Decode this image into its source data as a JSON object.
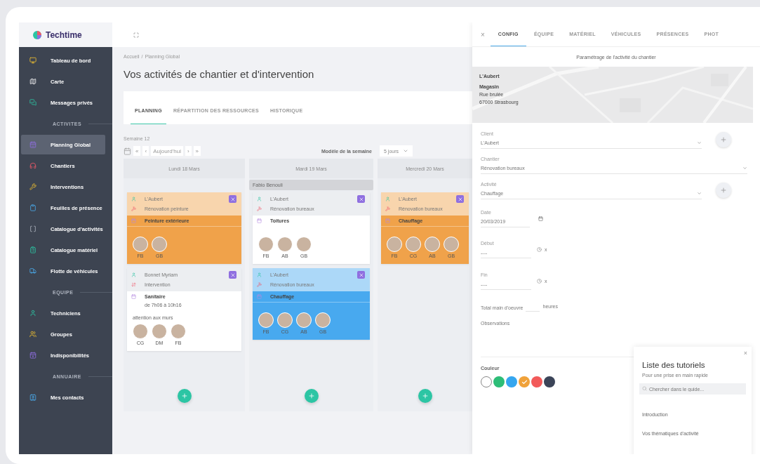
{
  "brand": "Techtime",
  "sidebar": {
    "items": [
      {
        "kind": "item",
        "label": "Tableau de bord",
        "selected": false
      },
      {
        "kind": "item",
        "label": "Carte",
        "selected": false
      },
      {
        "kind": "item",
        "label": "Messages privés",
        "selected": false
      },
      {
        "kind": "section",
        "label": "ACTIVITES"
      },
      {
        "kind": "item",
        "label": "Planning Global",
        "selected": true
      },
      {
        "kind": "item",
        "label": "Chantiers",
        "selected": false
      },
      {
        "kind": "item",
        "label": "Interventions",
        "selected": false
      },
      {
        "kind": "item",
        "label": "Feuilles de présence",
        "selected": false
      },
      {
        "kind": "item",
        "label": "Catalogue d'activités",
        "selected": false
      },
      {
        "kind": "item",
        "label": "Catalogue matériel",
        "selected": false
      },
      {
        "kind": "item",
        "label": "Flotte de véhicules",
        "selected": false
      },
      {
        "kind": "section",
        "label": "EQUIPE"
      },
      {
        "kind": "item",
        "label": "Techniciens",
        "selected": false
      },
      {
        "kind": "item",
        "label": "Groupes",
        "selected": false
      },
      {
        "kind": "item",
        "label": "Indisponibilités",
        "selected": false
      },
      {
        "kind": "section",
        "label": "ANNUAIRE"
      },
      {
        "kind": "item",
        "label": "Mes contacts",
        "selected": false
      }
    ]
  },
  "breadcrumb": [
    "Accueil",
    "/",
    "Planning Global"
  ],
  "title": "Vos activités de chantier et d'intervention",
  "tabs": [
    {
      "label": "PLANNING",
      "selected": true
    },
    {
      "label": "RÉPARTITION DES RESSOURCES",
      "selected": false
    },
    {
      "label": "HISTORIQUE",
      "selected": false
    }
  ],
  "week": "Semaine 12",
  "toolbar": {
    "first": "«",
    "prev": "‹",
    "today": "Aujourd'hui",
    "next": "›",
    "last": "»",
    "model_label": "Modèle de la semaine",
    "model_value": "5 jours"
  },
  "columns": [
    {
      "day": "Lundi 18 Mars",
      "cards": [
        {
          "color": "#f0a24a",
          "client": "L'Aubert",
          "site": "Rénovation peinture",
          "kind": "worksite",
          "activity": "Peinture extérieure",
          "team": [
            "FB",
            "GB"
          ]
        },
        {
          "color": "#ffffff",
          "client": "Bonnet Myriam",
          "site": "Intervention",
          "kind": "service",
          "activity": "Sanitaire",
          "time": "de 7h06 à 10h16",
          "note": "attention aux murs",
          "team": [
            "CG",
            "DM",
            "FB"
          ]
        }
      ]
    },
    {
      "day": "Mardi 19 Mars",
      "absence": "Fabio Benouli",
      "cards": [
        {
          "color": "#ffffff",
          "client": "L'Aubert",
          "site": "Rénovation bureaux",
          "kind": "worksite",
          "activity": "Toitures",
          "team": [
            "FB",
            "AB",
            "GB"
          ]
        },
        {
          "color": "#48a9ef",
          "client": "L'Aubert",
          "site": "Rénovation bureaux",
          "kind": "worksite",
          "activity": "Chauffage",
          "team": [
            "FB",
            "CG",
            "AB",
            "GB"
          ]
        }
      ]
    },
    {
      "day": "Mercredi 20 Mars",
      "cards": [
        {
          "color": "#f0a24a",
          "client": "L'Aubert",
          "site": "Rénovation bureaux",
          "kind": "worksite",
          "activity": "Chauffage",
          "team": [
            "FB",
            "CG",
            "AB",
            "GB"
          ]
        }
      ]
    }
  ],
  "panel": {
    "close": "×",
    "tabs": [
      {
        "label": "CONFIG",
        "selected": true
      },
      {
        "label": "ÉQUIPE",
        "selected": false
      },
      {
        "label": "MATÉRIEL",
        "selected": false
      },
      {
        "label": "VÉHICULES",
        "selected": false
      },
      {
        "label": "PRÉSENCES",
        "selected": false
      },
      {
        "label": "PHOT",
        "selected": false
      }
    ],
    "subtitle": "Paramétrage de l'activité du chantier",
    "address": {
      "name": "L'Aubert",
      "place": "Magasin",
      "street": "Rue brulée",
      "city": "67000 Strasbourg"
    },
    "fields": [
      {
        "kind": "select",
        "label": "Client",
        "value": "L'Aubert",
        "add": true
      },
      {
        "kind": "select",
        "label": "Chantier",
        "value": "Rénovation bureaux",
        "add": false
      },
      {
        "kind": "select",
        "label": "Activité",
        "value": "Chauffage",
        "add": true
      },
      {
        "kind": "date",
        "label": "Date",
        "value": "20/03/2019"
      },
      {
        "kind": "time",
        "label": "Début",
        "value": "----",
        "clear": "x"
      },
      {
        "kind": "time",
        "label": "Fin",
        "value": "----",
        "clear": "x"
      }
    ],
    "total": {
      "label": "Total main d'oeuvre",
      "unit": "heures"
    },
    "observations": "Observations",
    "color_label": "Couleur",
    "swatches": [
      {
        "color": "#ffffff",
        "selected": false
      },
      {
        "color": "#2dbd77",
        "selected": false
      },
      {
        "color": "#35a6ef",
        "selected": false
      },
      {
        "color": "#f0a23a",
        "selected": true
      },
      {
        "color": "#f25a5a",
        "selected": false
      },
      {
        "color": "#3b4458",
        "selected": false
      }
    ]
  },
  "tutorials": {
    "close": "×",
    "title": "Liste des tutoriels",
    "subtitle": "Pour une prise en main rapide",
    "placeholder": "Chercher dans le guide...",
    "items": [
      "Introduction",
      "Vos thématiques d'activité"
    ]
  }
}
